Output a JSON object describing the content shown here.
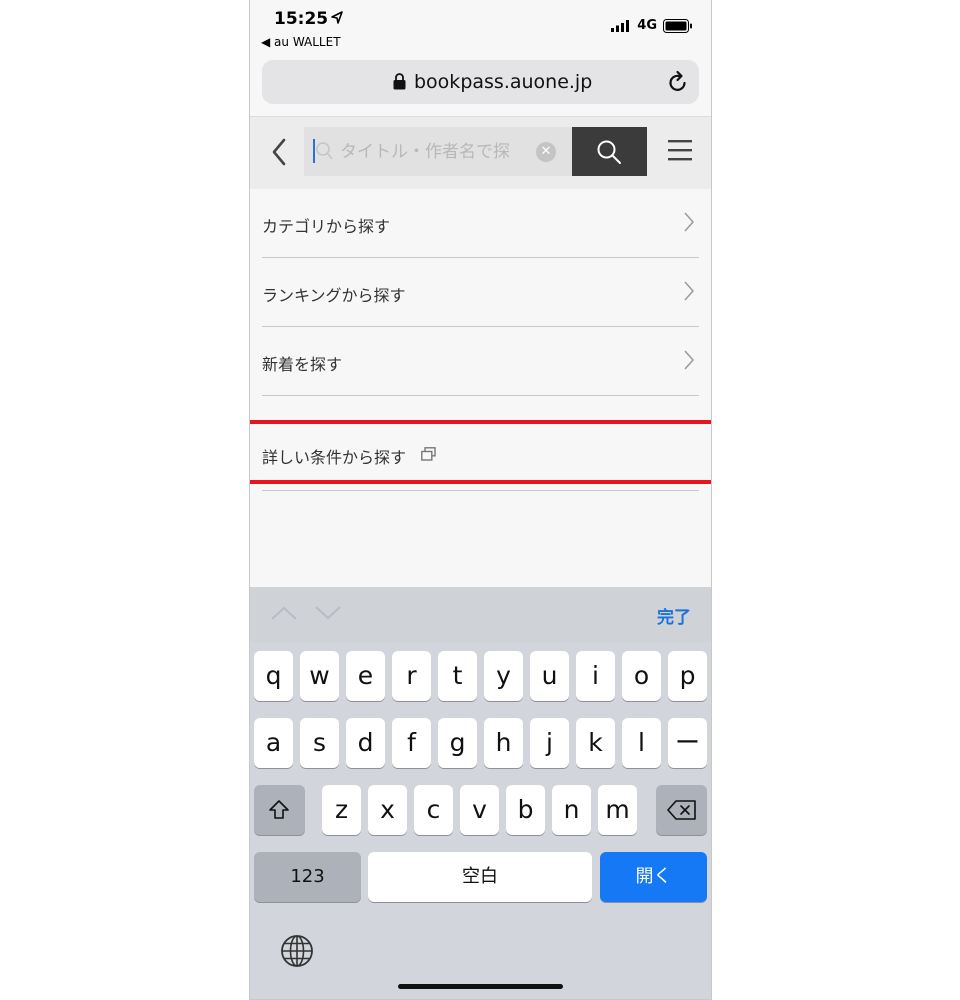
{
  "status_bar": {
    "time": "15:25",
    "back_app": "◀ au WALLET",
    "network": "4G"
  },
  "browser": {
    "url": "bookpass.auone.jp"
  },
  "header": {
    "search_placeholder": "タイトル・作者名で探"
  },
  "menu": {
    "items": [
      {
        "label": "カテゴリから探す"
      },
      {
        "label": "ランキングから探す"
      },
      {
        "label": "新着を探す"
      }
    ],
    "advanced": {
      "label": "詳しい条件から探す"
    }
  },
  "accessory": {
    "done_label": "完了"
  },
  "keyboard": {
    "row1": [
      "q",
      "w",
      "e",
      "r",
      "t",
      "y",
      "u",
      "i",
      "o",
      "p"
    ],
    "row2": [
      "a",
      "s",
      "d",
      "f",
      "g",
      "h",
      "j",
      "k",
      "l",
      "ー"
    ],
    "row3": [
      "z",
      "x",
      "c",
      "v",
      "b",
      "n",
      "m"
    ],
    "numbers_label": "123",
    "space_label": "空白",
    "go_label": "開く"
  },
  "colors": {
    "highlight": "#e8141c",
    "accent": "#1579f6",
    "done": "#1a73d9"
  }
}
